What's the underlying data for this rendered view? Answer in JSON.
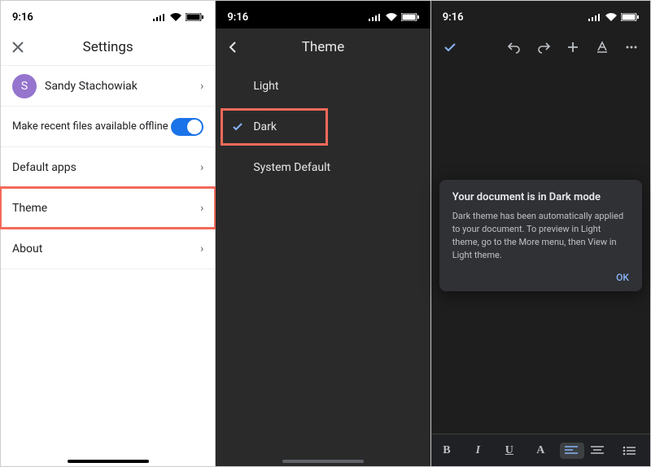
{
  "status_time": "9:16",
  "screen1": {
    "title": "Settings",
    "user": {
      "initial": "S",
      "name": "Sandy Stachowiak"
    },
    "offline_label": "Make recent files available offline",
    "offline_on": true,
    "rows": {
      "default_apps": "Default apps",
      "theme": "Theme",
      "about": "About"
    }
  },
  "screen2": {
    "title": "Theme",
    "options": {
      "light": "Light",
      "dark": "Dark",
      "system": "System Default"
    },
    "selected": "dark"
  },
  "screen3": {
    "popup": {
      "title": "Your document is in Dark mode",
      "body": "Dark theme has been automatically applied to your document. To preview in Light theme, go to the More menu, then View in Light theme.",
      "ok": "OK"
    },
    "format_bar": {
      "b": "B",
      "i": "I",
      "u": "U",
      "a": "A"
    }
  }
}
